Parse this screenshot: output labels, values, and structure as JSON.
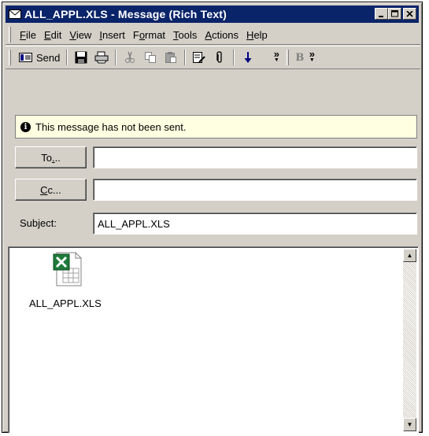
{
  "window": {
    "title": "ALL_APPL.XLS - Message (Rich Text)",
    "controls": {
      "minimize": "_",
      "maximize": "□",
      "close": "✕"
    }
  },
  "menu": [
    "File",
    "Edit",
    "View",
    "Insert",
    "Format",
    "Tools",
    "Actions",
    "Help"
  ],
  "toolbar": {
    "send_label": "Send",
    "more_glyph": "»",
    "bold_label": "B",
    "icons": [
      "send-icon",
      "save-icon",
      "print-icon",
      "cut-icon",
      "copy-icon",
      "paste-icon",
      "address-book-icon",
      "attach-icon",
      "importance-low-icon"
    ]
  },
  "info": {
    "text": "This message has not been sent."
  },
  "fields": {
    "to_button": "To...",
    "cc_button": "Cc...",
    "to_value": "",
    "cc_value": "",
    "subject_label": "Subject:",
    "subject_value": "ALL_APPL.XLS"
  },
  "body": {
    "attachment": {
      "name": "ALL_APPL.XLS",
      "icon": "excel-file-icon"
    }
  },
  "colors": {
    "titlebar": "#0a246a",
    "face": "#d4d0c8",
    "info_bg": "#ffffe1",
    "excel_green": "#1d7a3a"
  }
}
